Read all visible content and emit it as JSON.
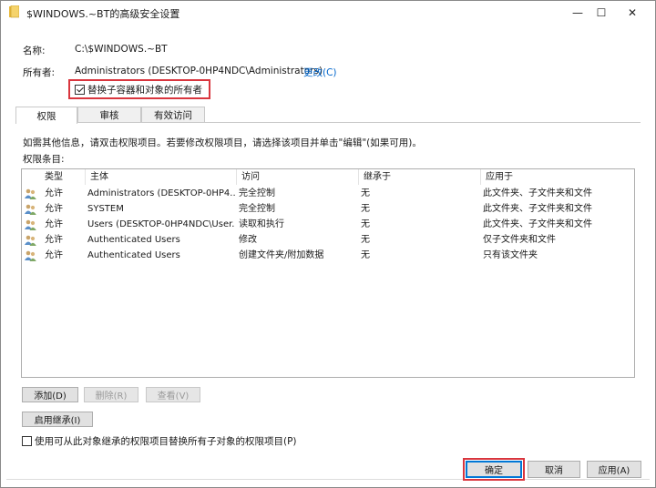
{
  "window": {
    "title": "$WINDOWS.~BT的高级安全设置",
    "minimize_glyph": "—",
    "maximize_glyph": "☐",
    "close_glyph": "✕"
  },
  "info": {
    "name_label": "名称:",
    "name_value": "C:\\$WINDOWS.~BT",
    "owner_label": "所有者:",
    "owner_value": "Administrators (DESKTOP-0HP4NDC\\Administrators)",
    "change_link": "更改(C)",
    "replace_owner_label": "替换子容器和对象的所有者",
    "replace_owner_checked": true
  },
  "tabs": [
    {
      "label": "权限",
      "active": true
    },
    {
      "label": "审核",
      "active": false
    },
    {
      "label": "有效访问",
      "active": false
    }
  ],
  "hint": "如需其他信息，请双击权限项目。若要修改权限项目，请选择该项目并单击\"编辑\"(如果可用)。",
  "entries_label": "权限条目:",
  "table": {
    "headers": [
      "类型",
      "主体",
      "访问",
      "继承于",
      "应用于"
    ],
    "rows": [
      [
        "允许",
        "Administrators (DESKTOP-0HP4...",
        "完全控制",
        "无",
        "此文件夹、子文件夹和文件"
      ],
      [
        "允许",
        "SYSTEM",
        "完全控制",
        "无",
        "此文件夹、子文件夹和文件"
      ],
      [
        "允许",
        "Users (DESKTOP-0HP4NDC\\User...",
        "读取和执行",
        "无",
        "此文件夹、子文件夹和文件"
      ],
      [
        "允许",
        "Authenticated Users",
        "修改",
        "无",
        "仅子文件夹和文件"
      ],
      [
        "允许",
        "Authenticated Users",
        "创建文件夹/附加数据",
        "无",
        "只有该文件夹"
      ]
    ]
  },
  "buttons": {
    "add": "添加(D)",
    "remove": "删除(R)",
    "view": "查看(V)",
    "enable_inheritance": "启用继承(I)",
    "replace_child_perms": "使用可从此对象继承的权限项目替换所有子对象的权限项目(P)",
    "replace_child_perms_checked": false,
    "ok": "确定",
    "cancel": "取消",
    "apply": "应用(A)"
  },
  "colors": {
    "highlight_red": "#d9363e",
    "link_blue": "#0066cc",
    "folder_yellow": "#e8b93c"
  }
}
